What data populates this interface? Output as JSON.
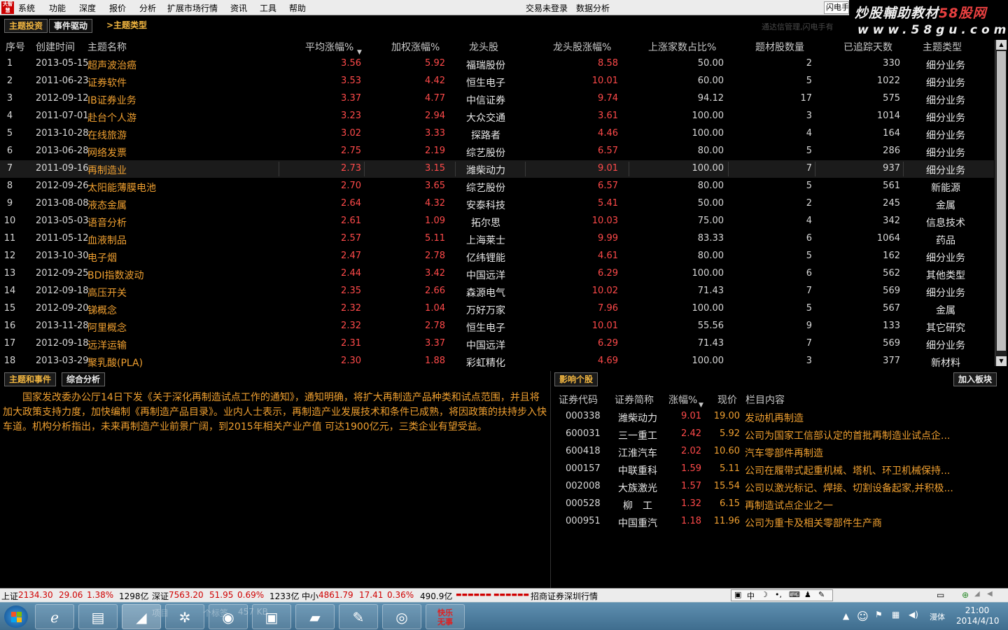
{
  "menubar": {
    "logo": "大智慧",
    "items": [
      "系统",
      "功能",
      "深度",
      "报价",
      "分析",
      "扩展市场行情",
      "资讯",
      "工具",
      "帮助"
    ],
    "center_items": [
      "交易未登录",
      "数据分析"
    ],
    "right_box": "闪电手"
  },
  "watermark": {
    "line1a": "炒股輔助教材",
    "line1b": "58股网",
    "line2": "www.58gu.com"
  },
  "top_tabs": {
    "tab1": "主题投资",
    "tab2": "事件驱动",
    "tab3": ">主题类型"
  },
  "hint_text": "通达信管理,闪电手有",
  "table": {
    "headers": [
      "序号",
      "创建时间",
      "主题名称",
      "平均涨幅%",
      "加权涨幅%",
      "龙头股",
      "龙头股涨幅%",
      "上涨家数占比%",
      "题材股数量",
      "已追踪天数",
      "主题类型"
    ],
    "rows": [
      {
        "no": "1",
        "date": "2013-05-15",
        "theme": "超声波治癌",
        "avg": "3.56",
        "wavg": "5.92",
        "leader": "福瑞股份",
        "lchg": "8.58",
        "ratio": "50.00",
        "count": "2",
        "days": "330",
        "type": "细分业务"
      },
      {
        "no": "2",
        "date": "2011-06-23",
        "theme": "证券软件",
        "avg": "3.53",
        "wavg": "4.42",
        "leader": "恒生电子",
        "lchg": "10.01",
        "ratio": "60.00",
        "count": "5",
        "days": "1022",
        "type": "细分业务"
      },
      {
        "no": "3",
        "date": "2012-09-12",
        "theme": "IB证券业务",
        "avg": "3.37",
        "wavg": "4.77",
        "leader": "中信证券",
        "lchg": "9.74",
        "ratio": "94.12",
        "count": "17",
        "days": "575",
        "type": "细分业务"
      },
      {
        "no": "4",
        "date": "2011-07-01",
        "theme": "赴台个人游",
        "avg": "3.23",
        "wavg": "2.94",
        "leader": "大众交通",
        "lchg": "3.61",
        "ratio": "100.00",
        "count": "3",
        "days": "1014",
        "type": "细分业务"
      },
      {
        "no": "5",
        "date": "2013-10-28",
        "theme": "在线旅游",
        "avg": "3.02",
        "wavg": "3.33",
        "leader": "探路者",
        "lchg": "4.46",
        "ratio": "100.00",
        "count": "4",
        "days": "164",
        "type": "细分业务"
      },
      {
        "no": "6",
        "date": "2013-06-28",
        "theme": "网络发票",
        "avg": "2.75",
        "wavg": "2.19",
        "leader": "综艺股份",
        "lchg": "6.57",
        "ratio": "80.00",
        "count": "5",
        "days": "286",
        "type": "细分业务"
      },
      {
        "no": "7",
        "date": "2011-09-16",
        "theme": "再制造业",
        "avg": "2.73",
        "wavg": "3.15",
        "leader": "潍柴动力",
        "lchg": "9.01",
        "ratio": "100.00",
        "count": "7",
        "days": "937",
        "type": "细分业务"
      },
      {
        "no": "8",
        "date": "2012-09-26",
        "theme": "太阳能薄膜电池",
        "avg": "2.70",
        "wavg": "3.65",
        "leader": "综艺股份",
        "lchg": "6.57",
        "ratio": "80.00",
        "count": "5",
        "days": "561",
        "type": "新能源"
      },
      {
        "no": "9",
        "date": "2013-08-08",
        "theme": "液态金属",
        "avg": "2.64",
        "wavg": "4.32",
        "leader": "安泰科技",
        "lchg": "5.41",
        "ratio": "50.00",
        "count": "2",
        "days": "245",
        "type": "金属"
      },
      {
        "no": "10",
        "date": "2013-05-03",
        "theme": "语音分析",
        "avg": "2.61",
        "wavg": "1.09",
        "leader": "拓尔思",
        "lchg": "10.03",
        "ratio": "75.00",
        "count": "4",
        "days": "342",
        "type": "信息技术"
      },
      {
        "no": "11",
        "date": "2011-05-12",
        "theme": "血液制品",
        "avg": "2.57",
        "wavg": "5.11",
        "leader": "上海莱士",
        "lchg": "9.99",
        "ratio": "83.33",
        "count": "6",
        "days": "1064",
        "type": "药品"
      },
      {
        "no": "12",
        "date": "2013-10-30",
        "theme": "电子烟",
        "avg": "2.47",
        "wavg": "2.78",
        "leader": "亿纬锂能",
        "lchg": "4.61",
        "ratio": "80.00",
        "count": "5",
        "days": "162",
        "type": "细分业务"
      },
      {
        "no": "13",
        "date": "2012-09-25",
        "theme": "BDI指数波动",
        "avg": "2.44",
        "wavg": "3.42",
        "leader": "中国远洋",
        "lchg": "6.29",
        "ratio": "100.00",
        "count": "6",
        "days": "562",
        "type": "其他类型"
      },
      {
        "no": "14",
        "date": "2012-09-18",
        "theme": "高压开关",
        "avg": "2.35",
        "wavg": "2.66",
        "leader": "森源电气",
        "lchg": "10.02",
        "ratio": "71.43",
        "count": "7",
        "days": "569",
        "type": "细分业务"
      },
      {
        "no": "15",
        "date": "2012-09-20",
        "theme": "锑概念",
        "avg": "2.32",
        "wavg": "1.04",
        "leader": "万好万家",
        "lchg": "7.96",
        "ratio": "100.00",
        "count": "5",
        "days": "567",
        "type": "金属"
      },
      {
        "no": "16",
        "date": "2013-11-28",
        "theme": "阿里概念",
        "avg": "2.32",
        "wavg": "2.78",
        "leader": "恒生电子",
        "lchg": "10.01",
        "ratio": "55.56",
        "count": "9",
        "days": "133",
        "type": "其它研究"
      },
      {
        "no": "17",
        "date": "2012-09-18",
        "theme": "远洋运输",
        "avg": "2.31",
        "wavg": "3.37",
        "leader": "中国远洋",
        "lchg": "6.29",
        "ratio": "71.43",
        "count": "7",
        "days": "569",
        "type": "细分业务"
      },
      {
        "no": "18",
        "date": "2013-03-29",
        "theme": "聚乳酸(PLA)",
        "avg": "2.30",
        "wavg": "1.88",
        "leader": "彩虹精化",
        "lchg": "4.69",
        "ratio": "100.00",
        "count": "3",
        "days": "377",
        "type": "新材料"
      }
    ]
  },
  "left_panel": {
    "tab1": "主题和事件",
    "tab2": "综合分析",
    "text": "国家发改委办公厅14日下发《关于深化再制造试点工作的通知》，通知明确，将扩大再制造产品种类和试点范围，并且将加大政策支持力度，加快编制《再制造产品目录》。业内人士表示，再制造产业发展技术和条件已成熟，将因政策的扶持步入快车道。机构分析指出，未来再制造产业前景广阔，到2015年相关产业产值 可达1900亿元，三类企业有望受益。"
  },
  "right_panel": {
    "tab": "影响个股",
    "add_button": "加入板块",
    "headers": [
      "证券代码",
      "证券简称",
      "涨幅%",
      "现价",
      "栏目内容"
    ],
    "rows": [
      {
        "code": "000338",
        "name": "潍柴动力",
        "chg": "9.01",
        "price": "19.00",
        "content": "发动机再制造"
      },
      {
        "code": "600031",
        "name": "三一重工",
        "chg": "2.42",
        "price": "5.92",
        "content": "公司为国家工信部认定的首批再制造业试点企..."
      },
      {
        "code": "600418",
        "name": "江淮汽车",
        "chg": "2.02",
        "price": "10.60",
        "content": "汽车零部件再制造"
      },
      {
        "code": "000157",
        "name": "中联重科",
        "chg": "1.59",
        "price": "5.11",
        "content": "公司在履带式起重机械、塔机、环卫机械保持..."
      },
      {
        "code": "002008",
        "name": "大族激光",
        "chg": "1.57",
        "price": "15.54",
        "content": "公司以激光标记、焊接、切割设备起家,并积极..."
      },
      {
        "code": "000528",
        "name": "柳　工",
        "chg": "1.32",
        "price": "6.15",
        "content": "再制造试点企业之一"
      },
      {
        "code": "000951",
        "name": "中国重汽",
        "chg": "1.18",
        "price": "11.96",
        "content": "公司为重卡及相关零部件生产商"
      }
    ]
  },
  "statusbar": {
    "sh_label": "上证",
    "sh_value": "2134.30",
    "sh_chg": "29.06",
    "sh_pct": "1.38%",
    "sh_vol": "1298亿",
    "sz_label": "深证",
    "sz_value": "7563.20",
    "sz_chg": "51.95",
    "sz_pct": "0.69%",
    "sz_vol": "1233亿",
    "zx_label": "中小",
    "zx_value": "4861.79",
    "zx_chg": "17.41",
    "zx_pct": "0.36%",
    "zx_vol": "490.9亿",
    "bars": "▬▬▬▬▬▬ ▬▬▬▬▬▬",
    "broker": "招商证券深圳行情",
    "ime": "中"
  },
  "taskbar": {
    "ghost1": "项目",
    "ghost2": "个标签",
    "ghost3": "457 KB",
    "app_label": "快乐\n无事",
    "tray_text": "漫体",
    "time": "21:00",
    "date": "2014/4/10"
  }
}
